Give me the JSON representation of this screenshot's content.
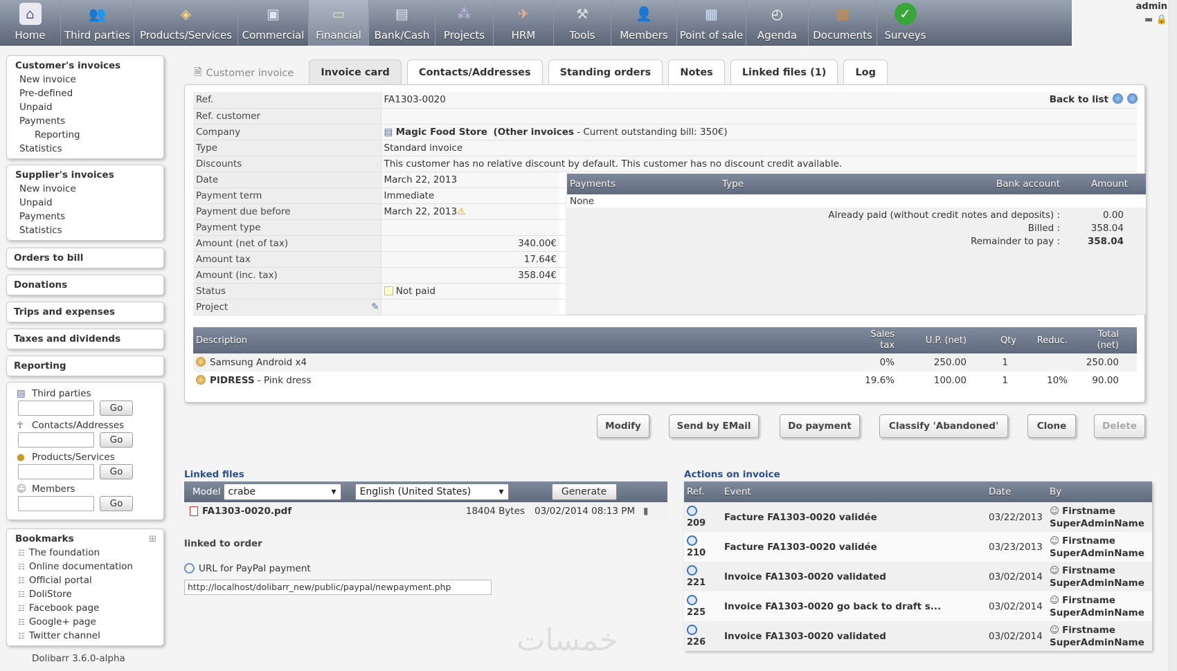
{
  "topmenu": [
    {
      "label": "Home",
      "icon": "home-icon"
    },
    {
      "label": "Third parties",
      "icon": "users-icon"
    },
    {
      "label": "Products/Services",
      "icon": "box-icon"
    },
    {
      "label": "Commercial",
      "icon": "briefcase-icon"
    },
    {
      "label": "Financial",
      "icon": "money-icon"
    },
    {
      "label": "Bank/Cash",
      "icon": "bank-icon"
    },
    {
      "label": "Projects",
      "icon": "projects-icon"
    },
    {
      "label": "HRM",
      "icon": "hrm-icon"
    },
    {
      "label": "Tools",
      "icon": "tools-icon"
    },
    {
      "label": "Members",
      "icon": "members-icon"
    },
    {
      "label": "Point of sale",
      "icon": "pos-icon"
    },
    {
      "label": "Agenda",
      "icon": "clock-icon"
    },
    {
      "label": "Documents",
      "icon": "documents-icon"
    },
    {
      "label": "Surveys",
      "icon": "check-icon"
    }
  ],
  "login": {
    "user": "admin"
  },
  "leftmenu": {
    "customer_invoices": {
      "title": "Customer's invoices",
      "items": [
        "New invoice",
        "Pre-defined",
        "Unpaid",
        "Payments"
      ],
      "subitem": "Reporting",
      "last": "Statistics"
    },
    "supplier_invoices": {
      "title": "Supplier's invoices",
      "items": [
        "New invoice",
        "Unpaid",
        "Payments",
        "Statistics"
      ]
    },
    "singles": [
      "Orders to bill",
      "Donations",
      "Trips and expenses",
      "Taxes and dividends",
      "Reporting"
    ],
    "search": {
      "third_parties": "Third parties",
      "contacts": "Contacts/Addresses",
      "products": "Products/Services",
      "members": "Members",
      "go": "Go"
    },
    "bookmarks": {
      "title": "Bookmarks",
      "items": [
        "The foundation",
        "Online documentation",
        "Official portal",
        "DoliStore",
        "Facebook page",
        "Google+ page",
        "Twitter channel"
      ]
    },
    "version": "Dolibarr 3.6.0-alpha"
  },
  "tabs": {
    "head": "Customer invoice",
    "items": [
      "Invoice card",
      "Contacts/Addresses",
      "Standing orders",
      "Notes",
      "Linked files (1)",
      "Log"
    ]
  },
  "card": {
    "back_to_list": "Back to list",
    "rows": {
      "ref": {
        "label": "Ref.",
        "value": "FA1303-0020"
      },
      "ref_customer": {
        "label": "Ref. customer",
        "value": ""
      },
      "company": {
        "label": "Company",
        "name": "Magic Food Store",
        "other": "(Other invoices",
        "outstanding": "- Current outstanding bill: 350€)"
      },
      "type": {
        "label": "Type",
        "value": "Standard invoice"
      },
      "discounts": {
        "label": "Discounts",
        "value": "This customer has no relative discount by default. This customer has no discount credit available."
      },
      "date": {
        "label": "Date",
        "value": "March 22, 2013"
      },
      "payment_term": {
        "label": "Payment term",
        "value": "Immediate"
      },
      "due": {
        "label": "Payment due before",
        "value": "March 22, 2013"
      },
      "payment_type": {
        "label": "Payment type",
        "value": ""
      },
      "amount_net": {
        "label": "Amount (net of tax)",
        "value": "340.00€"
      },
      "amount_tax": {
        "label": "Amount tax",
        "value": "17.64€"
      },
      "amount_inc": {
        "label": "Amount (inc. tax)",
        "value": "358.04€"
      },
      "status": {
        "label": "Status",
        "value": "Not paid"
      },
      "project": {
        "label": "Project",
        "value": ""
      }
    },
    "payments": {
      "headers": [
        "Payments",
        "Type",
        "Bank account",
        "Amount"
      ],
      "none": "None",
      "already_paid_label": "Already paid (without credit notes and deposits) :",
      "already_paid": "0.00",
      "billed_label": "Billed :",
      "billed": "358.04",
      "remainder_label": "Remainder to pay :",
      "remainder": "358.04"
    },
    "lines": {
      "headers": {
        "description": "Description",
        "sales_tax_1": "Sales",
        "sales_tax_2": "tax",
        "up": "U.P. (net)",
        "qty": "Qty",
        "reduc": "Reduc.",
        "total_1": "Total",
        "total_2": "(net)"
      },
      "rows": [
        {
          "ref": "",
          "desc": "Samsung Android x4",
          "tax": "0%",
          "up": "250.00",
          "qty": "1",
          "reduc": "",
          "total": "250.00"
        },
        {
          "ref": "PIDRESS",
          "desc": " - Pink dress",
          "tax": "19.6%",
          "up": "100.00",
          "qty": "1",
          "reduc": "10%",
          "total": "90.00"
        }
      ]
    }
  },
  "actions": [
    "Modify",
    "Send by EMail",
    "Do payment",
    "Classify 'Abandoned'",
    "Clone",
    "Delete"
  ],
  "linked_files": {
    "title": "Linked files",
    "model_label": "Model",
    "model": "crabe",
    "language": "English (United States)",
    "generate": "Generate",
    "file": {
      "name": "FA1303-0020.pdf",
      "size": "18404 Bytes",
      "date": "03/02/2014 08:13 PM"
    }
  },
  "linked_order": "linked to order",
  "paypal": {
    "label": "URL for PayPal payment",
    "url": "http://localhost/dolibarr_new/public/paypal/newpayment.php"
  },
  "events": {
    "title": "Actions on invoice",
    "headers": [
      "Ref.",
      "Event",
      "Date",
      "By"
    ],
    "rows": [
      {
        "ref": "209",
        "event": "Facture FA1303-0020 validée",
        "date": "03/22/2013",
        "first": "Firstname",
        "last": "SuperAdminName"
      },
      {
        "ref": "210",
        "event": "Facture FA1303-0020 validée",
        "date": "03/23/2013",
        "first": "Firstname",
        "last": "SuperAdminName"
      },
      {
        "ref": "221",
        "event": "Invoice FA1303-0020 validated",
        "date": "03/02/2014",
        "first": "Firstname",
        "last": "SuperAdminName"
      },
      {
        "ref": "225",
        "event": "Invoice FA1303-0020 go back to draft s...",
        "date": "03/02/2014",
        "first": "Firstname",
        "last": "SuperAdminName"
      },
      {
        "ref": "226",
        "event": "Invoice FA1303-0020 validated",
        "date": "03/02/2014",
        "first": "Firstname",
        "last": "SuperAdminName"
      }
    ]
  },
  "watermark": "خمسات"
}
